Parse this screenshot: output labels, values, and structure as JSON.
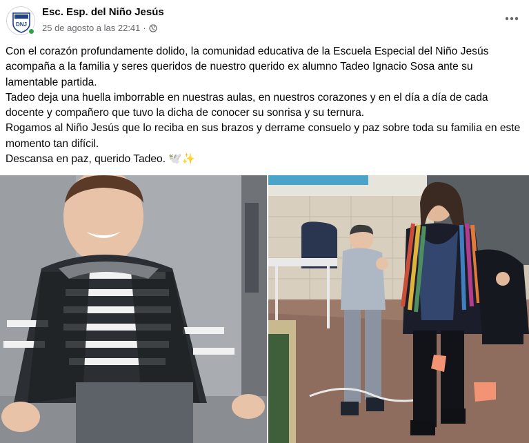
{
  "post": {
    "page_name": "Esc. Esp. del Niño Jesús",
    "timestamp": "25 de agosto a las 22:41",
    "separator": "·",
    "audience_icon": "globe-icon",
    "more_icon": "more-options-icon",
    "avatar_logo_text": "DNJ",
    "online_color": "#31a24c",
    "paragraphs": [
      "Con el corazón profundamente dolido, la comunidad educativa de la Escuela Especial del Niño Jesús acompaña a la familia y seres queridos de nuestro querido ex alumno Tadeo Ignacio Sosa ante su lamentable partida.",
      "Tadeo deja una huella imborrable en nuestras aulas, en nuestros corazones y en el día a día de cada docente y compañero que tuvo la dicha de conocer su sonrisa y su ternura.",
      "Rogamos al Niño Jesús que lo reciba en sus brazos y derrame consuelo y paz sobre toda su familia en este momento tan difícil.",
      "Descansa en paz, querido Tadeo. 🕊️✨"
    ]
  },
  "photos": [
    {
      "name": "photo-child-striped-sweater"
    },
    {
      "name": "photo-classroom-walk"
    }
  ]
}
